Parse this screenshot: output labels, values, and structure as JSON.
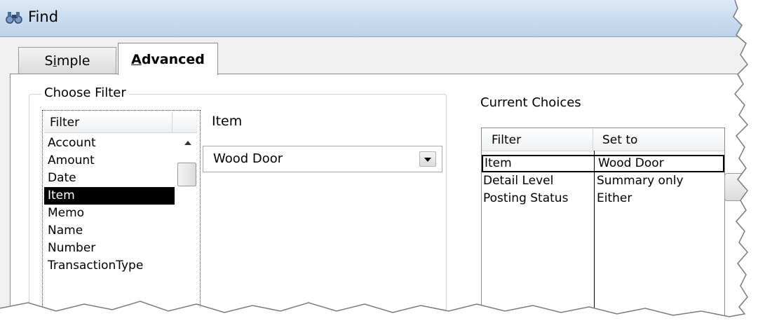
{
  "window": {
    "title": "Find",
    "icon": "find-binoculars-icon"
  },
  "tabs": [
    {
      "label_prefix": "S",
      "label_accel": "i",
      "label_rest": "mple",
      "selected": false
    },
    {
      "label_prefix": "",
      "label_accel": "A",
      "label_rest": "dvanced",
      "selected": true
    }
  ],
  "choose_filter": {
    "legend": "Choose Filter",
    "list_header": "Filter",
    "items": [
      "Account",
      "Amount",
      "Date",
      "Item",
      "Memo",
      "Name",
      "Number",
      "TransactionType"
    ],
    "selected_item": "Item"
  },
  "filter_detail": {
    "label": "Item",
    "dropdown_value": "Wood Door"
  },
  "current_choices": {
    "label": "Current Choices",
    "columns": [
      "Filter",
      "Set to"
    ],
    "rows": [
      {
        "filter": "Item",
        "set_to": "Wood Door"
      },
      {
        "filter": "Detail Level",
        "set_to": "Summary only"
      },
      {
        "filter": "Posting Status",
        "set_to": "Either"
      }
    ]
  },
  "colors": {
    "titlebar": "#c9dcf0",
    "selection_bg": "#000000",
    "selection_fg": "#ffffff",
    "dialog_bg": "#f0f0f0"
  }
}
